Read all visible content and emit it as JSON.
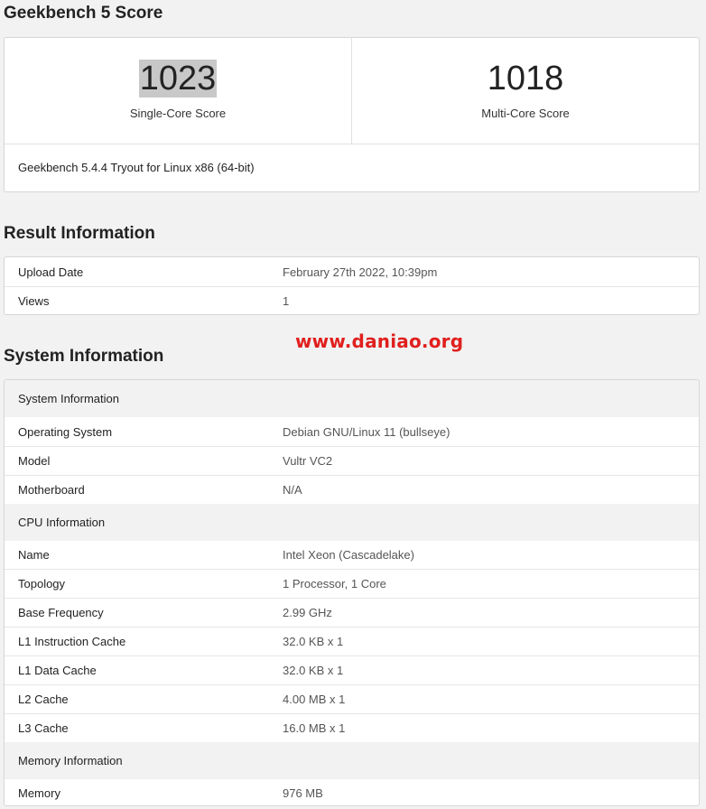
{
  "score_section": {
    "title": "Geekbench 5 Score",
    "single_core": {
      "value": "1023",
      "label": "Single-Core Score"
    },
    "multi_core": {
      "value": "1018",
      "label": "Multi-Core Score"
    },
    "version": "Geekbench 5.4.4 Tryout for Linux x86 (64-bit)"
  },
  "result_section": {
    "title": "Result Information",
    "rows": [
      {
        "label": "Upload Date",
        "value": "February 27th 2022, 10:39pm"
      },
      {
        "label": "Views",
        "value": "1"
      }
    ]
  },
  "watermark": "www.daniao.org",
  "system_section": {
    "title": "System Information",
    "groups": [
      {
        "header": "System Information",
        "rows": [
          {
            "label": "Operating System",
            "value": "Debian GNU/Linux 11 (bullseye)"
          },
          {
            "label": "Model",
            "value": "Vultr VC2"
          },
          {
            "label": "Motherboard",
            "value": "N/A"
          }
        ]
      },
      {
        "header": "CPU Information",
        "rows": [
          {
            "label": "Name",
            "value": "Intel Xeon (Cascadelake)"
          },
          {
            "label": "Topology",
            "value": "1 Processor, 1 Core"
          },
          {
            "label": "Base Frequency",
            "value": "2.99 GHz"
          },
          {
            "label": "L1 Instruction Cache",
            "value": "32.0 KB x 1"
          },
          {
            "label": "L1 Data Cache",
            "value": "32.0 KB x 1"
          },
          {
            "label": "L2 Cache",
            "value": "4.00 MB x 1"
          },
          {
            "label": "L3 Cache",
            "value": "16.0 MB x 1"
          }
        ]
      },
      {
        "header": "Memory Information",
        "rows": [
          {
            "label": "Memory",
            "value": "976 MB"
          }
        ]
      }
    ]
  }
}
